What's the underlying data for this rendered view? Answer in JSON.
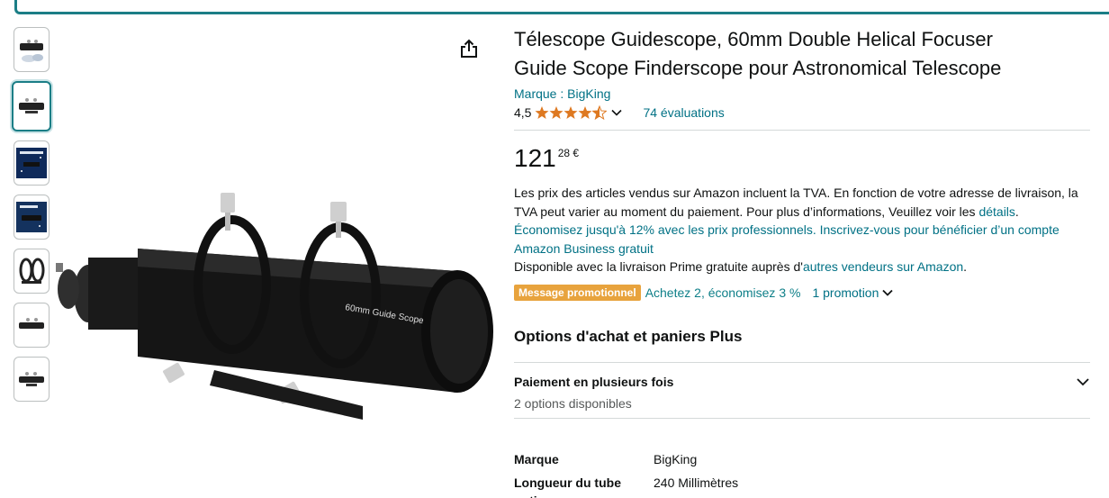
{
  "product": {
    "title_line1": "Télescope Guidescope, 60mm Double Helical Focuser",
    "title_line2": "Guide Scope Finderscope pour Astronomical Telescope",
    "brand_link": "Marque : BigKing",
    "rating_value": "4,5",
    "stars": 4.5,
    "reviews_link": "74 évaluations",
    "image_label": "60mm Guide Scope"
  },
  "price": {
    "whole": "121",
    "fraction": "28 €"
  },
  "tva": {
    "text": "Les prix des articles vendus sur Amazon incluent la TVA. En fonction de votre adresse de livraison, la TVA peut varier au moment du paiement. Pour plus d’informations, Veuillez voir les ",
    "link": "détails",
    "end": "."
  },
  "business": {
    "link": "Économisez jusqu'à 12% avec les prix professionnels. Inscrivez-vous pour bénéficier d’un compte Amazon Business gratuit"
  },
  "prime": {
    "text": "Disponible avec la livraison Prime gratuite auprès d'",
    "link": "autres vendeurs sur Amazon",
    "end": "."
  },
  "promotion": {
    "badge": "Message promotionnel",
    "text": "Achetez 2, économisez 3 %",
    "link": "1 promotion"
  },
  "options": {
    "title": "Options d'achat et paniers Plus",
    "payment_title": "Paiement en plusieurs fois",
    "payment_sub": "2 options disponibles"
  },
  "specs": [
    {
      "key": "Marque",
      "value": "BigKing"
    },
    {
      "key": "Longueur du tube optique",
      "value": "240 Millimètres"
    }
  ],
  "colors": {
    "link": "#007185",
    "accent": "#1b7e86",
    "star": "#de7921",
    "badge": "#e8a33d"
  }
}
